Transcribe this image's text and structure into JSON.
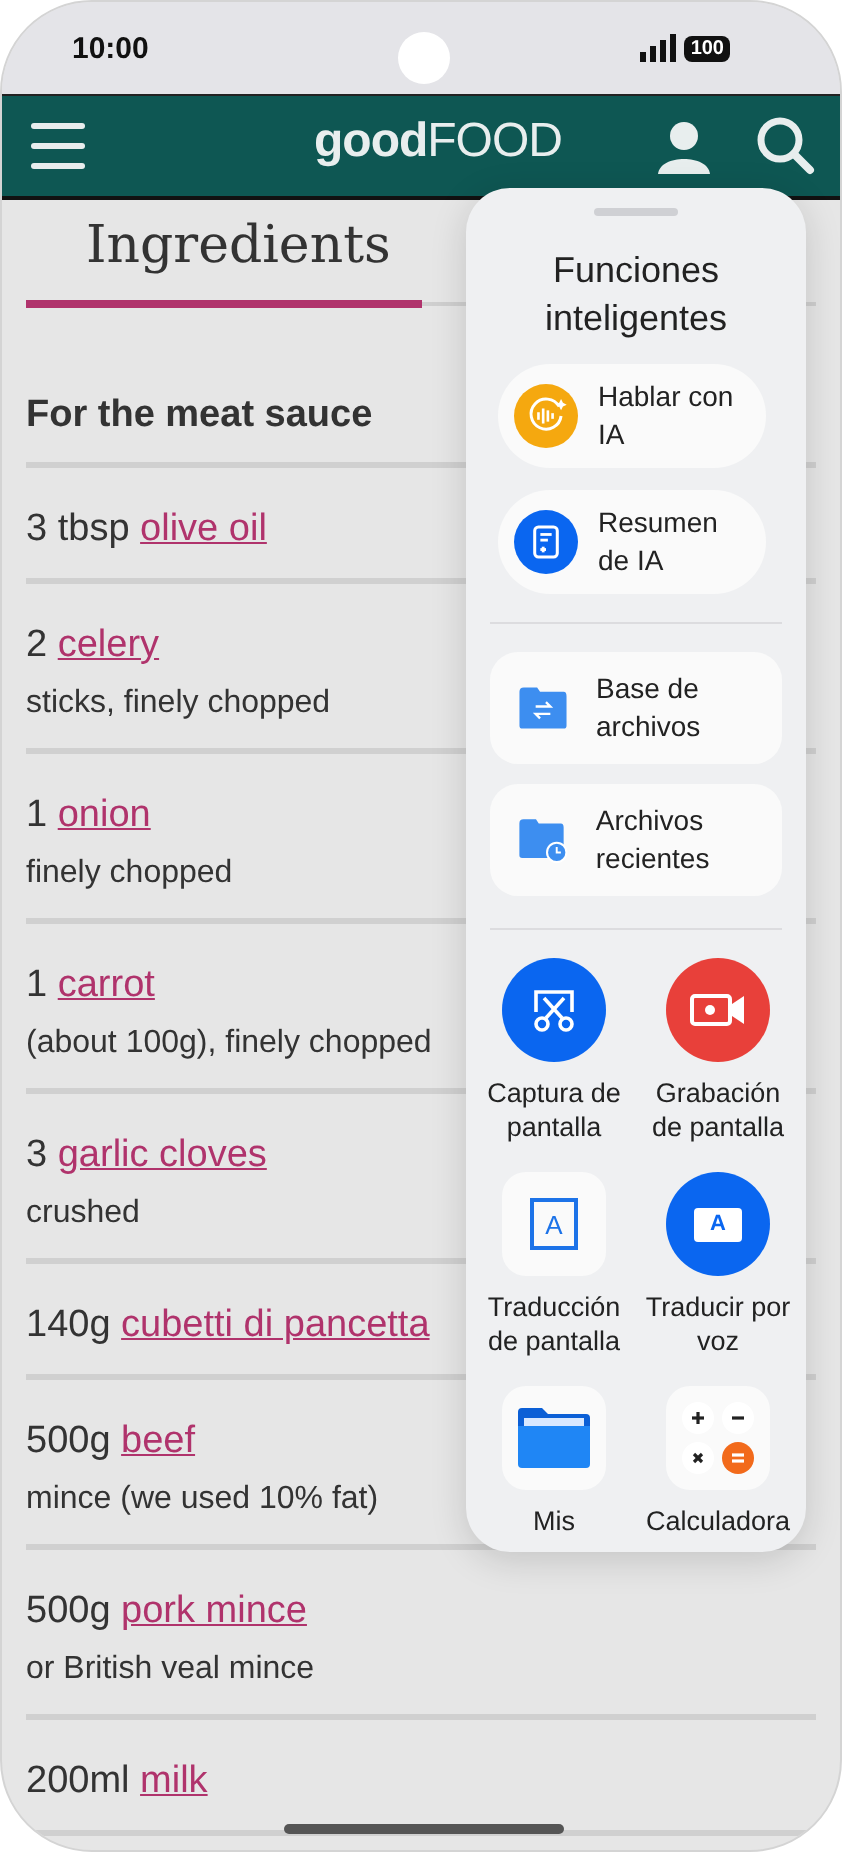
{
  "status_bar": {
    "time": "10:00",
    "battery": "100"
  },
  "header": {
    "logo": "**good**FOOD"
  },
  "tabs": [
    {
      "label": "Ingredients",
      "selected": true
    }
  ],
  "section_heading": "For the meat sauce",
  "ingredients": [
    {
      "amount": "3 tbsp",
      "link": "olive oil"
    },
    {
      "amount": "2",
      "link": "celery",
      "note": "sticks, finely chopped"
    },
    {
      "amount": "1",
      "link": "onion",
      "note": "finely chopped"
    },
    {
      "amount": "1",
      "link": "carrot",
      "note": "(about 100g), finely chopped"
    },
    {
      "amount": "3",
      "link": "garlic cloves",
      "note": "crushed"
    },
    {
      "amount": "140g",
      "link": "cubetti di pancetta"
    },
    {
      "amount": "500g",
      "link": "beef",
      "note": "mince (we used 10% fat)"
    },
    {
      "amount": "500g",
      "link": "pork mince",
      "note": "or British veal mince"
    },
    {
      "amount": "200ml",
      "link": "milk"
    }
  ],
  "panel": {
    "title": "Funciones inteligentes",
    "ai_items": [
      {
        "kind": "voice",
        "label": "Hablar con IA"
      },
      {
        "kind": "summary",
        "label": "Resumen de IA"
      }
    ],
    "file_items": [
      {
        "kind": "base",
        "label": "Base de archivos"
      },
      {
        "kind": "recent",
        "label": "Archivos recientes"
      }
    ],
    "tools": [
      {
        "kind": "capture",
        "label": "Captura de pantalla"
      },
      {
        "kind": "record",
        "label": "Grabación de pantalla"
      },
      {
        "kind": "translate-screen",
        "label": "Traducción de pantalla",
        "glyph": "A"
      },
      {
        "kind": "translate-voice",
        "label": "Traducir por voz",
        "glyph": "A"
      },
      {
        "kind": "files",
        "label": "Mis"
      },
      {
        "kind": "calculator",
        "label": "Calculadora"
      }
    ]
  }
}
